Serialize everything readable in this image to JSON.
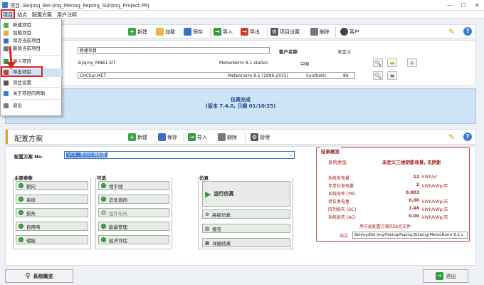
{
  "window": {
    "title": "项目: Beijing_Bei-jing_Peking_Peping_Sijiqing_Project.PRJ",
    "min": "—",
    "max": "☐",
    "close": "✕"
  },
  "menubar": {
    "items": [
      "项目",
      "站点",
      "配置方案",
      "用户注释"
    ]
  },
  "menu": {
    "items": [
      {
        "label": "新建项目",
        "icon": "new-file-icon",
        "color": "#4caf50"
      },
      {
        "label": "加载项目",
        "icon": "folder-icon",
        "color": "#e0b030"
      },
      {
        "label": "保存当前项目",
        "icon": "save-icon",
        "color": "#3a6fc4"
      },
      {
        "label": "删除当前项目",
        "icon": "trash-icon",
        "color": "#777777"
      },
      {
        "label": "导入项目",
        "icon": "import-icon",
        "color": "#2e9e3e"
      },
      {
        "label": "导出项目",
        "icon": "export-icon",
        "color": "#d03a2a"
      },
      {
        "label": "项目设置",
        "icon": "gear-icon",
        "color": "#555555"
      },
      {
        "label": "关于项目的帮助",
        "icon": "help-icon",
        "color": "#3a7bd5"
      },
      {
        "label": "退出",
        "icon": "exit-icon",
        "color": "#777777"
      }
    ]
  },
  "project_toolbar": {
    "new": "新建",
    "load": "加载",
    "save": "保存",
    "import": "导入",
    "export": "导出",
    "settings": "项目设置",
    "delete": "删除",
    "client": "客户"
  },
  "project": {
    "name_value": "新建项目",
    "client_label": "客户名称",
    "client_value": "未定义",
    "site_file": "Sijiqing_MN81.SIT",
    "site_source": "MeteoNorm 8.1 station",
    "country": "中国",
    "met_file": "CHChur.MET",
    "met_source": "Meteonorm 8.1 (1996-2015)",
    "met_type": "Synthetic",
    "met_num": "86"
  },
  "simulation": {
    "line1": "仿真完成",
    "line2": "(版本 7.4.0, 日期 01/10/25)"
  },
  "variants_toolbar": {
    "title": "配置方案",
    "new": "新建",
    "save": "保存",
    "import": "导入",
    "delete": "删除",
    "manage": "管理"
  },
  "variant": {
    "label": "配置方案 No.",
    "value": "VC0    : 新的仿真配置"
  },
  "main_params": {
    "title": "主要参数",
    "items": [
      "朝向",
      "系统",
      "损失",
      "自用电",
      "储能"
    ]
  },
  "optional": {
    "title": "可选",
    "items": [
      "地平线",
      "近处遮挡",
      "组件布局",
      "能量管理",
      "经济评估"
    ],
    "disabled": [
      2
    ]
  },
  "simulation_group": {
    "title": "仿真",
    "run": "运行仿真",
    "advanced": "高级仿真",
    "report": "报告",
    "detailed": "详细结果"
  },
  "results": {
    "title": "结果概览",
    "system_type_label": "系统类型",
    "system_type_value": "未定义三维阴影场景, 无阴影",
    "rows": [
      {
        "label": "系统发电量",
        "value": "12",
        "unit": "kWh/yr"
      },
      {
        "label": "年单位发电量",
        "value": "2",
        "unit": "kWh/kWp/年"
      },
      {
        "label": "系统效率 (PR)",
        "value": "0.003",
        "unit": ""
      },
      {
        "label": "单位发电量",
        "value": "0.00",
        "unit": "kWh/kWp/天"
      },
      {
        "label": "阵列损失 (DC)",
        "value": "1.48",
        "unit": "kWh/kWp/天"
      },
      {
        "label": "系统损失 (AC)",
        "value": "0.00",
        "unit": "kWh/kWp/天"
      }
    ],
    "site_file_caption": "用于此配置方案的站点文件:",
    "site_label": "站点",
    "site_value": "Beijing/Bei-jing/Peking/Peping/Sijiqing/MeteoNorm 8.1 s"
  },
  "bottom": {
    "overview": "系统概览",
    "exit": "退出"
  }
}
